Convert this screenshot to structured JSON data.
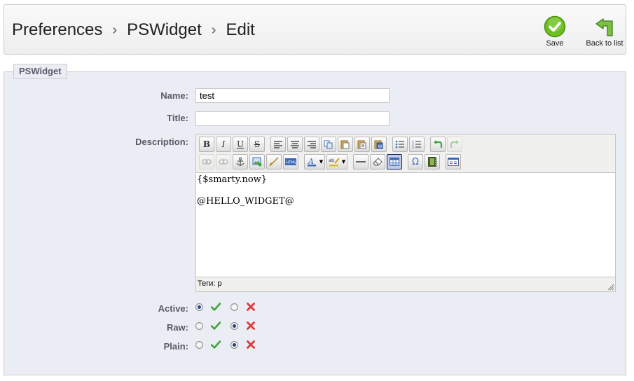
{
  "header": {
    "breadcrumb": [
      "Preferences",
      "PSWidget",
      "Edit"
    ],
    "separator": "›",
    "save_label": "Save",
    "back_label": "Back to list"
  },
  "form": {
    "legend": "PSWidget",
    "name_label": "Name:",
    "name_value": "test",
    "title_label": "Title:",
    "title_value": "",
    "description_label": "Description:",
    "description_lines": [
      "{$smarty.now}",
      "@HELLO_WIDGET@"
    ],
    "editor_status": "Теги: p",
    "active_label": "Active:",
    "raw_label": "Raw:",
    "plain_label": "Plain:",
    "active_value": "yes",
    "raw_value": "no",
    "plain_value": "no"
  },
  "colors": {
    "yes_green": "#3fa43a",
    "no_red": "#e0393b",
    "save_circle": "#6cbf1e",
    "label_text": "#585a69"
  },
  "icons": {
    "editor_row1": [
      "bold",
      "italic",
      "underline",
      "strikethrough",
      "align-left",
      "align-center",
      "align-right",
      "copy",
      "paste",
      "paste-text",
      "paste-word",
      "bullet-list",
      "numbered-list",
      "undo",
      "redo"
    ],
    "editor_row2": [
      "link",
      "unlink",
      "anchor",
      "image",
      "cleanup",
      "html",
      "text-color",
      "highlight-color",
      "horizontal-rule",
      "remove-format",
      "table",
      "special-char",
      "media",
      "page-break"
    ]
  }
}
